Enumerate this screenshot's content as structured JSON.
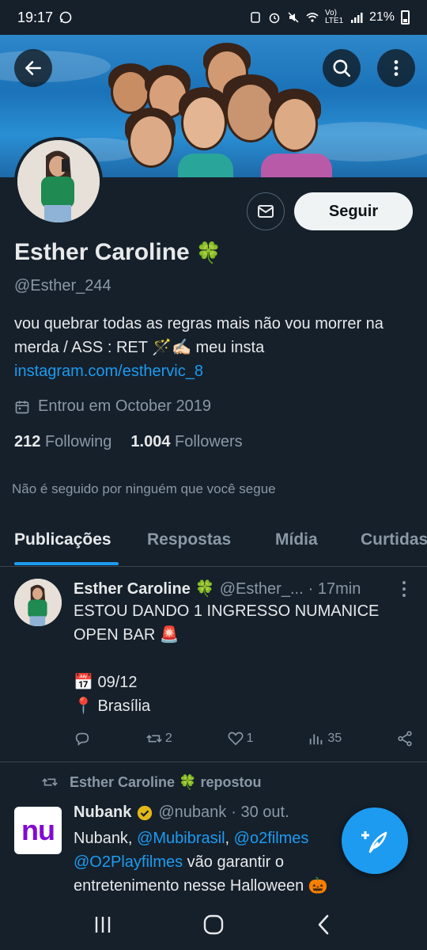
{
  "status_bar": {
    "time": "19:17",
    "network": "Vo) LTE1",
    "battery": "21%"
  },
  "profile": {
    "name": "Esther Caroline",
    "name_emoji": "🍀",
    "handle": "@Esther_244",
    "bio_line": "vou quebrar todas as regras mais não vou morrer na merda / ASS : RET 🪄✍🏻 meu insta",
    "bio_link": "instagram.com/esthervic_8",
    "joined": "Entrou em October 2019",
    "following_count": "212",
    "following_label": "Following",
    "followers_count": "1.004",
    "followers_label": "Followers",
    "not_followed": "Não é seguido por ninguém que você segue",
    "follow_button": "Seguir"
  },
  "tabs": [
    {
      "label": "Publicações",
      "active": true
    },
    {
      "label": "Respostas",
      "active": false
    },
    {
      "label": "Mídia",
      "active": false
    },
    {
      "label": "Curtidas",
      "active": false
    }
  ],
  "posts": [
    {
      "author": "Esther Caroline",
      "author_emoji": "🍀",
      "handle": "@Esther_...",
      "time": "· 17min",
      "lines": [
        "ESTOU DANDO 1 INGRESSO NUMANICE",
        "OPEN BAR 🚨",
        "",
        "📅 09/12",
        "📍 Brasília"
      ],
      "actions": {
        "reply": "",
        "repost": "2",
        "like": "1",
        "views": "35"
      }
    },
    {
      "repost_by": "Esther Caroline 🍀 repostou",
      "author": "Nubank",
      "handle": "@nubank",
      "time": "· 30 out.",
      "text_1": "Nubank, ",
      "mention_1": "@Mubibrasil",
      "text_2": ", ",
      "mention_2": "@o2filmes",
      "mention_3": "@O2Playfilmes",
      "text_3": " vão garantir o",
      "text_4": "entretenimento nesse Halloween 🎃",
      "logo_text": "nu"
    }
  ],
  "colors": {
    "background": "#15202b",
    "accent": "#1d9bf0",
    "secondary_text": "#8b98a5"
  }
}
